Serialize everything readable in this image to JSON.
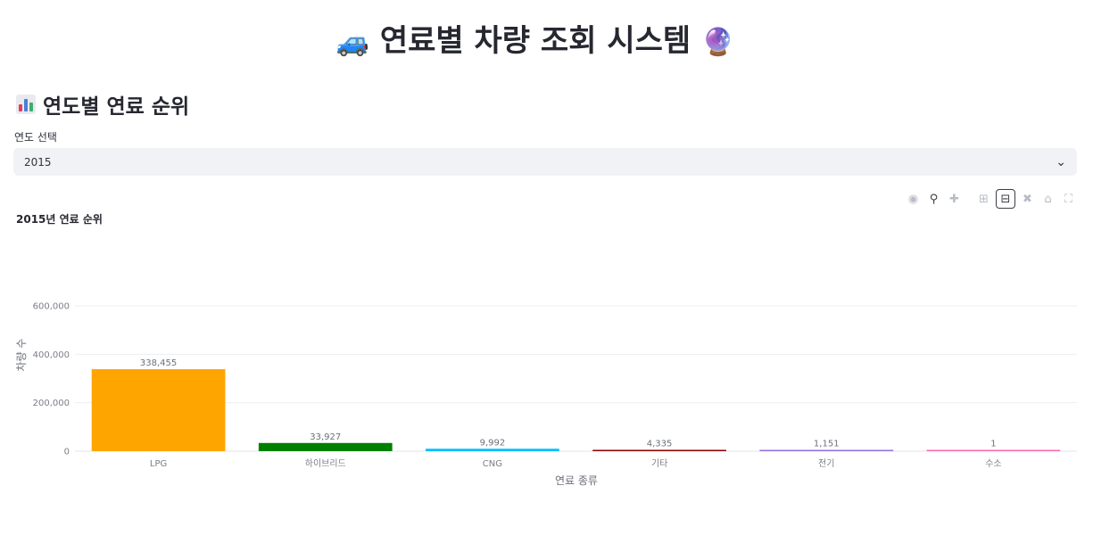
{
  "page": {
    "title": "연료별 차량 조회 시스템",
    "title_emoji_left": "🚙",
    "title_emoji_right": "🔮"
  },
  "section": {
    "title": "연도별 연료 순위",
    "icon": "bar-chart-icon"
  },
  "year_select": {
    "label": "연도 선택",
    "value": "2015"
  },
  "modebar": {
    "buttons": [
      "camera-icon",
      "zoom-icon",
      "pan-icon",
      "zoom-in-icon",
      "zoom-out-icon",
      "autoscale-icon",
      "home-icon",
      "fullscreen-icon"
    ]
  },
  "chart_data": {
    "type": "bar",
    "title": "2015년 연료 순위",
    "xlabel": "연료 종류",
    "ylabel": "차량 수",
    "categories": [
      "LPG",
      "하이브리드",
      "CNG",
      "기타",
      "전기",
      "수소"
    ],
    "values": [
      338455,
      33927,
      9992,
      4335,
      1151,
      1
    ],
    "value_labels": [
      "338,455",
      "33,927",
      "9,992",
      "4,335",
      "1,151",
      "1"
    ],
    "colors": [
      "#ffa500",
      "#008000",
      "#00bfff",
      "#8b0000",
      "#9370db",
      "#ff69b4"
    ],
    "yticks": [
      0,
      200000,
      400000,
      600000
    ],
    "ytick_labels": [
      "0",
      "200,000",
      "400,000",
      "600,000"
    ],
    "ylim": [
      0,
      607000
    ],
    "grid": true
  }
}
